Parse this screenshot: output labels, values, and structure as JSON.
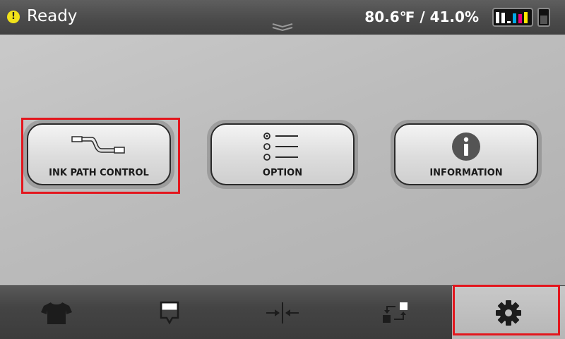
{
  "status": {
    "state_text": "Ready",
    "environment": "80.6℉ / 41.0%",
    "ink_levels": [
      {
        "color": "#ffffff",
        "level": 0.85
      },
      {
        "color": "#ffffff",
        "level": 0.8
      },
      {
        "color": "#ffffff",
        "level": 0.15
      },
      {
        "color": "#00a9e6",
        "level": 0.75
      },
      {
        "color": "#e6007e",
        "level": 0.7
      },
      {
        "color": "#ffe600",
        "level": 0.85
      }
    ],
    "waste_level": 0.55
  },
  "menu": {
    "items": [
      {
        "label": "INK PATH CONTROL",
        "icon": "ink-path-icon"
      },
      {
        "label": "OPTION",
        "icon": "option-list-icon"
      },
      {
        "label": "INFORMATION",
        "icon": "information-icon"
      }
    ]
  },
  "nav": {
    "items": [
      {
        "icon": "tshirt-icon"
      },
      {
        "icon": "ink-drop-icon"
      },
      {
        "icon": "platen-adjust-icon"
      },
      {
        "icon": "transfer-icon"
      },
      {
        "icon": "gear-icon",
        "active": true
      }
    ]
  },
  "colors": {
    "highlight": "#e3161d",
    "warning": "#f1e21a"
  }
}
